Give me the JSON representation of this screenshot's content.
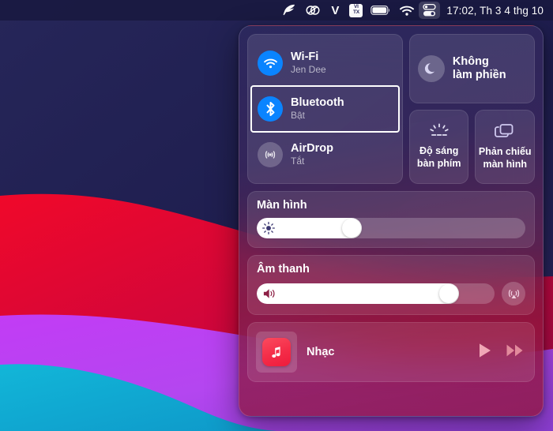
{
  "menubar": {
    "icons": [
      {
        "name": "feather-icon",
        "label": "Ulysses"
      },
      {
        "name": "creative-cloud-icon",
        "label": "Adobe Creative Cloud"
      },
      {
        "name": "letter-v-icon",
        "label": "V"
      },
      {
        "name": "vitx-icon",
        "label_top": "VI",
        "label_bottom": "TX"
      },
      {
        "name": "battery-icon",
        "label": "Battery"
      },
      {
        "name": "wifi-icon",
        "label": "Wi-Fi"
      },
      {
        "name": "control-center-icon",
        "label": "Control Center"
      }
    ],
    "clock": "17:02, Th 3 4 thg 10"
  },
  "control_center": {
    "connectivity": {
      "items": [
        {
          "icon": "wifi-icon",
          "title": "Wi-Fi",
          "subtitle": "Jen Dee",
          "state": "on",
          "selected": false
        },
        {
          "icon": "bluetooth-icon",
          "title": "Bluetooth",
          "subtitle": "Bật",
          "state": "on",
          "selected": true
        },
        {
          "icon": "airdrop-icon",
          "title": "AirDrop",
          "subtitle": "Tắt",
          "state": "off",
          "selected": false
        }
      ]
    },
    "do_not_disturb": {
      "icon": "moon-icon",
      "label_line1": "Không",
      "label_line2": "làm phiền"
    },
    "tiles": [
      {
        "icon": "keyboard-brightness-icon",
        "label_line1": "Độ sáng",
        "label_line2": "bàn phím"
      },
      {
        "icon": "screen-mirroring-icon",
        "label_line1": "Phản chiếu",
        "label_line2": "màn hình"
      }
    ],
    "display": {
      "title": "Màn hình",
      "icon": "brightness-icon",
      "value_percent": 39
    },
    "sound": {
      "title": "Âm thanh",
      "icon": "speaker-icon",
      "value_percent": 85,
      "airplay_icon": "airplay-audio-icon"
    },
    "music": {
      "app_icon": "apple-music-icon",
      "title": "Nhạc",
      "play_icon": "play-icon",
      "forward_icon": "fast-forward-icon"
    }
  },
  "colors": {
    "accent_blue": "#0a84ff",
    "music_red": "#f42c48",
    "panel_text": "#ffffff",
    "selection_outline": "#ffffff"
  }
}
